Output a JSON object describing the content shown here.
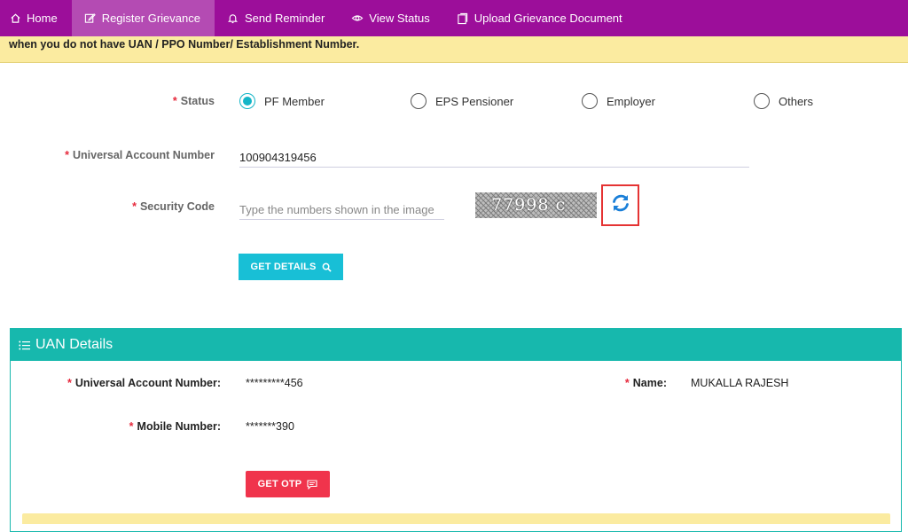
{
  "nav": {
    "items": [
      {
        "label": "Home",
        "icon": "home-icon"
      },
      {
        "label": "Register Grievance",
        "icon": "edit-icon"
      },
      {
        "label": "Send Reminder",
        "icon": "bell-icon"
      },
      {
        "label": "View Status",
        "icon": "eye-icon"
      },
      {
        "label": "Upload Grievance Document",
        "icon": "document-icon"
      }
    ],
    "active": "Register Grievance"
  },
  "notice": {
    "text": "when you do not have UAN / PPO Number/ Establishment Number."
  },
  "form": {
    "status": {
      "label": "Status",
      "options": [
        "PF Member",
        "EPS Pensioner",
        "Employer",
        "Others"
      ],
      "selected": "PF Member"
    },
    "uan": {
      "label": "Universal Account Number",
      "value": "100904319456"
    },
    "security": {
      "label": "Security Code",
      "placeholder": "Type the numbers shown in the image",
      "captcha_text": "77998 c"
    },
    "get_details_label": "GET DETAILS"
  },
  "uan_details": {
    "title": "UAN Details",
    "uan_label": "Universal Account Number:",
    "uan_value": "*********456",
    "name_label": "Name:",
    "name_value": "MUKALLA RAJESH",
    "mobile_label": "Mobile Number:",
    "mobile_value": "*******390",
    "get_otp_label": "GET OTP"
  },
  "colors": {
    "nav_bg": "#9c0e9a",
    "accent": "#18bfd6",
    "panel": "#17b8ad",
    "danger": "#f0344c",
    "notice": "#fbeba0"
  }
}
